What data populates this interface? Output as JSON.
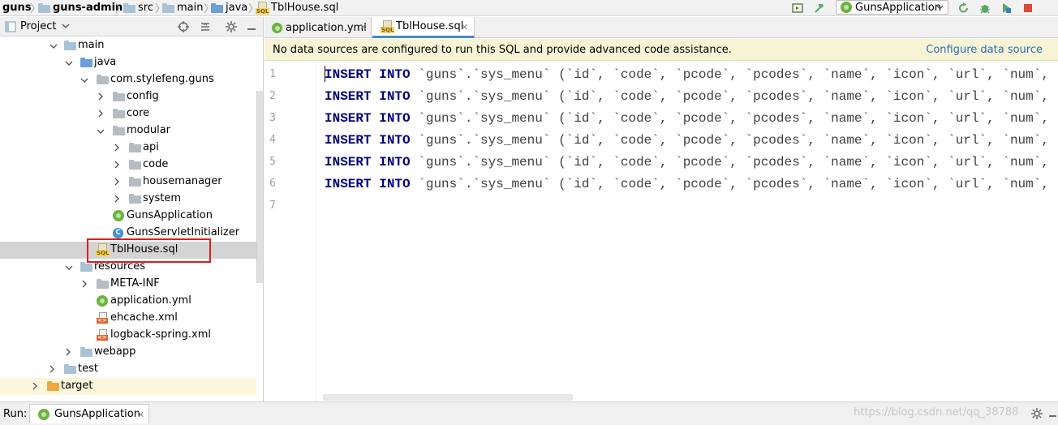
{
  "navbar": {
    "crumbs": [
      "guns",
      "guns-admin",
      "src",
      "main",
      "java",
      "TblHouse.sql"
    ],
    "run_config": "GunsApplication"
  },
  "project_panel": {
    "title": "Project",
    "tree": [
      {
        "label": "main",
        "icon": "folder"
      },
      {
        "label": "java",
        "icon": "folder-blue"
      },
      {
        "label": "com.stylefeng.guns",
        "icon": "package"
      },
      {
        "label": "config",
        "icon": "package"
      },
      {
        "label": "core",
        "icon": "package"
      },
      {
        "label": "modular",
        "icon": "package"
      },
      {
        "label": "api",
        "icon": "package"
      },
      {
        "label": "code",
        "icon": "package"
      },
      {
        "label": "housemanager",
        "icon": "package"
      },
      {
        "label": "system",
        "icon": "package"
      },
      {
        "label": "GunsApplication",
        "icon": "spring-class"
      },
      {
        "label": "GunsServletInitializer",
        "icon": "class"
      },
      {
        "label": "TblHouse.sql",
        "icon": "sql-file"
      },
      {
        "label": "resources",
        "icon": "folder-resources"
      },
      {
        "label": "META-INF",
        "icon": "folder"
      },
      {
        "label": "application.yml",
        "icon": "spring-yml"
      },
      {
        "label": "ehcache.xml",
        "icon": "xml-file"
      },
      {
        "label": "logback-spring.xml",
        "icon": "xml-file"
      },
      {
        "label": "webapp",
        "icon": "folder-web"
      },
      {
        "label": "test",
        "icon": "folder"
      },
      {
        "label": "target",
        "icon": "folder-orange"
      }
    ]
  },
  "editor": {
    "tabs": [
      {
        "label": "application.yml",
        "active": false
      },
      {
        "label": "TblHouse.sql",
        "active": true
      }
    ],
    "notice": {
      "message": "No data sources are configured to run this SQL and provide advanced code assistance.",
      "link": "Configure data source"
    },
    "line_numbers": [
      "1",
      "2",
      "3",
      "4",
      "5",
      "6",
      "7"
    ],
    "code_lines": [
      {
        "kw1": "INSERT",
        "kw2": "INTO",
        "rest": "`guns`.`sys_menu` (`id`, `code`, `pcode`, `pcodes`, `name`, `icon`, `url`, `num`, `levels"
      },
      {
        "kw1": "INSERT",
        "kw2": "INTO",
        "rest": "`guns`.`sys_menu` (`id`, `code`, `pcode`, `pcodes`, `name`, `icon`, `url`, `num`, `levels"
      },
      {
        "kw1": "INSERT",
        "kw2": "INTO",
        "rest": "`guns`.`sys_menu` (`id`, `code`, `pcode`, `pcodes`, `name`, `icon`, `url`, `num`, `levels"
      },
      {
        "kw1": "INSERT",
        "kw2": "INTO",
        "rest": "`guns`.`sys_menu` (`id`, `code`, `pcode`, `pcodes`, `name`, `icon`, `url`, `num`, `levels"
      },
      {
        "kw1": "INSERT",
        "kw2": "INTO",
        "rest": "`guns`.`sys_menu` (`id`, `code`, `pcode`, `pcodes`, `name`, `icon`, `url`, `num`, `levels"
      },
      {
        "kw1": "INSERT",
        "kw2": "INTO",
        "rest": "`guns`.`sys_menu` (`id`, `code`, `pcode`, `pcodes`, `name`, `icon`, `url`, `num`, `levels"
      }
    ]
  },
  "runbar": {
    "label": "Run:",
    "tab": "GunsApplication",
    "watermark": "https://blog.csdn.net/qq_38788"
  },
  "colors": {
    "keyword": "#000080",
    "notice_bg": "#f7f4d6",
    "link": "#2a6db5",
    "selection_box": "#e11b1b",
    "selected_row": "#d4d4d4"
  }
}
